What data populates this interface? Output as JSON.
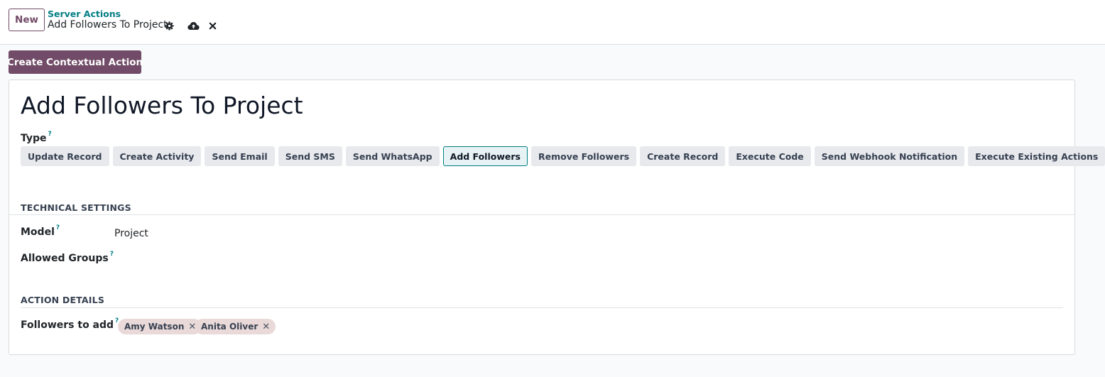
{
  "control_panel": {
    "new_label": "New",
    "breadcrumb_parent": "Server Actions",
    "breadcrumb_current": "Add Followers To Project",
    "icons": [
      "gear-icon",
      "cloud-upload-icon",
      "close-icon"
    ]
  },
  "contextual_action_label": "Create Contextual Action",
  "form": {
    "title": "Add Followers To Project",
    "type_label": "Type",
    "help_mark": "?",
    "type_options": [
      "Update Record",
      "Create Activity",
      "Send Email",
      "Send SMS",
      "Send WhatsApp",
      "Add Followers",
      "Remove Followers",
      "Create Record",
      "Execute Code",
      "Send Webhook Notification",
      "Execute Existing Actions"
    ],
    "selected_type": "Add Followers",
    "technical_settings": {
      "heading": "TECHNICAL SETTINGS",
      "model_label": "Model",
      "model_value": "Project",
      "allowed_groups_label": "Allowed Groups"
    },
    "action_details": {
      "heading": "ACTION DETAILS",
      "followers_label": "Followers to add",
      "followers": [
        "Amy Watson",
        "Anita Oliver"
      ],
      "remove_mark": "✕"
    }
  },
  "colors": {
    "primary": "#714b67",
    "accent": "#017e84",
    "tag_bg": "#e9d9d9"
  }
}
